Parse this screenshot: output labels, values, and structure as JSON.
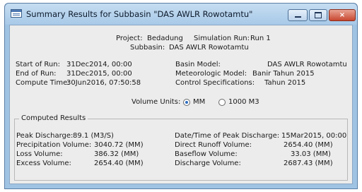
{
  "window": {
    "title": "Summary Results for Subbasin \"DAS AWLR Rowotamtu\"",
    "controls": {
      "minimize_icon": "minimize-icon",
      "maximize_icon": "maximize-icon",
      "close_glyph": "×"
    }
  },
  "header": {
    "project_label": "Project:",
    "project_value": "Bedadung",
    "run_label": "Simulation Run:",
    "run_value": "Run 1",
    "subbasin_label": "Subbasin:",
    "subbasin_value": "DAS AWLR Rowotamtu"
  },
  "run_info": {
    "start_label": "Start of Run:",
    "start_value": "31Dec2014, 00:00",
    "end_label": "End of Run:",
    "end_value": "31Dec2015, 00:00",
    "compute_label": "Compute Time:",
    "compute_value": "30Jun2016, 07:50:58",
    "basin_label": "Basin Model:",
    "basin_value": "DAS AWLR Rowotamtu",
    "met_label": "Meteorologic Model:",
    "met_value": "Banir Tahun 2015",
    "control_label": "Control Specifications:",
    "control_value": "Tahun 2015"
  },
  "units": {
    "label": "Volume Units:",
    "options": [
      {
        "label": "MM",
        "selected": true
      },
      {
        "label": "1000 M3",
        "selected": false
      }
    ]
  },
  "results": {
    "title": "Computed Results",
    "peak_discharge_label": "Peak Discharge:",
    "peak_discharge_value": "89.1 (M3/S)",
    "precip_label": "Precipitation Volume:",
    "precip_value": "3040.72 (MM)",
    "loss_label": "Loss Volume:",
    "loss_value": "386.32 (MM)",
    "excess_label": "Excess Volume:",
    "excess_value": "2654.40 (MM)",
    "peak_time_label": "Date/Time of Peak Discharge:",
    "peak_time_value": "15Mar2015, 00:00",
    "runoff_label": "Direct Runoff Volume:",
    "runoff_value": "2654.40 (MM)",
    "baseflow_label": "Baseflow Volume:",
    "baseflow_value": "33.03 (MM)",
    "discharge_label": "Discharge Volume:",
    "discharge_value": "2687.43 (MM)"
  }
}
